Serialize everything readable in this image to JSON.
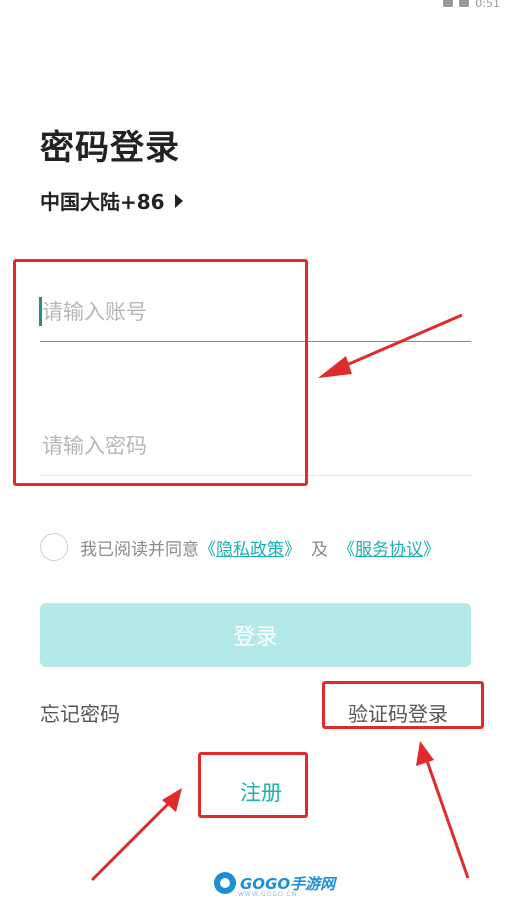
{
  "status_bar": {
    "time": "0:51"
  },
  "page_title": "密码登录",
  "region": {
    "label": "中国大陆+86"
  },
  "account_field": {
    "placeholder": "请输入账号",
    "value": ""
  },
  "password_field": {
    "placeholder": "请输入密码",
    "value": ""
  },
  "agreement": {
    "prefix": "我已阅读并同意",
    "open_bracket_1": "《",
    "privacy_link": "隐私政策",
    "close_bracket_1": "》",
    "and": "及",
    "open_bracket_2": "《",
    "service_link": "服务协议",
    "close_bracket_2": "》",
    "checked": false
  },
  "login_button": {
    "label": "登录"
  },
  "forgot_password": {
    "label": "忘记密码"
  },
  "sms_login": {
    "label": "验证码登录"
  },
  "register": {
    "label": "注册"
  },
  "watermark": {
    "brand": "GOGO手游网",
    "url": "WWW.GOGO.CN"
  },
  "colors": {
    "accent": "#1ab0b5",
    "button_disabled": "#b3e9e8",
    "annotation_red": "#e02b2b"
  }
}
